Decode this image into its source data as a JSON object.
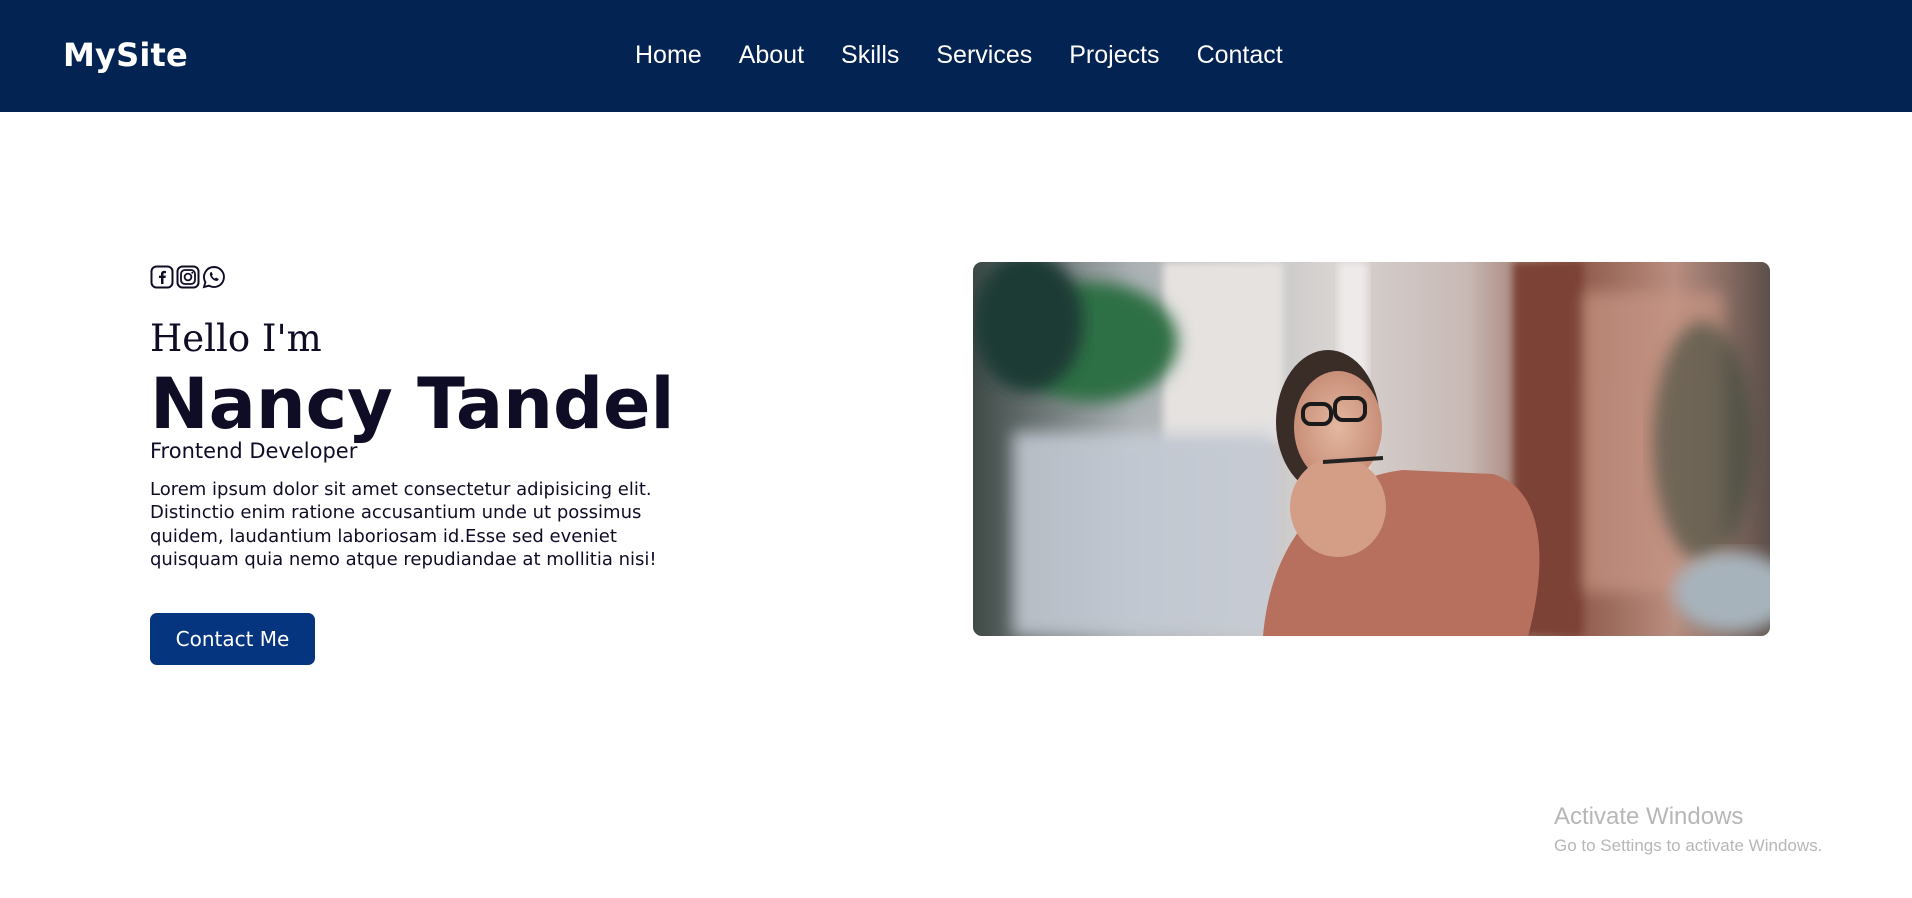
{
  "navbar": {
    "brand": "MySite",
    "links": [
      "Home",
      "About",
      "Skills",
      "Services",
      "Projects",
      "Contact"
    ]
  },
  "hero": {
    "social_icons": [
      "facebook-icon",
      "instagram-icon",
      "whatsapp-icon"
    ],
    "greeting": "Hello I'm",
    "name": "Nancy Tandel",
    "role": "Frontend Developer",
    "bio": "Lorem ipsum dolor sit amet consectetur adipisicing elit. Distinctio enim ratione accusantium unde ut possimus quidem, laudantium laboriosam id.Esse sed eveniet quisquam quia nemo atque repudiandae at mollitia nisi!",
    "cta_label": "Contact Me",
    "image_alt": "Woman with glasses thinking at a desk"
  },
  "watermark": {
    "title": "Activate Windows",
    "subtitle": "Go to Settings to activate Windows."
  },
  "colors": {
    "navbar_bg": "#032352",
    "button_bg": "#063580",
    "text_dark": "#0f0c26"
  }
}
